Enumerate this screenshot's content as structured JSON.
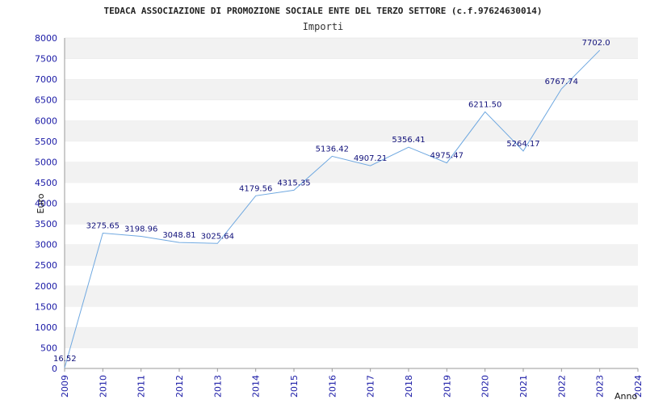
{
  "chart_data": {
    "type": "line",
    "title": "TEDACA ASSOCIAZIONE DI PROMOZIONE SOCIALE ENTE DEL TERZO SETTORE (c.f.97624630014)",
    "subtitle": "Importi",
    "xlabel": "Anno",
    "ylabel": "Euro",
    "ylim": [
      0,
      8000
    ],
    "ytick_step": 500,
    "grid": true,
    "x": [
      "2009",
      "2010",
      "2011",
      "2012",
      "2013",
      "2014",
      "2015",
      "2016",
      "2017",
      "2018",
      "2019",
      "2020",
      "2021",
      "2022",
      "2023",
      "2024"
    ],
    "values": [
      16.52,
      3275.65,
      3198.96,
      3048.81,
      3025.64,
      4179.56,
      4315.35,
      5136.42,
      4907.21,
      5356.41,
      4975.47,
      6211.5,
      5264.17,
      6767.74,
      7702.0
    ],
    "labels": [
      "16.52",
      "3275.65",
      "3198.96",
      "3048.81",
      "3025.64",
      "4179.56",
      "4315.35",
      "5136.42",
      "4907.21",
      "5356.41",
      "4975.47",
      "6211.50",
      "5264.17",
      "6767.74",
      "7702.0"
    ],
    "colors": {
      "line": "#6fa8e0",
      "band": "#f2f2f2",
      "tick_text": "#1a1aa6",
      "label_text": "#10107a",
      "grid": "#dddddd"
    }
  }
}
